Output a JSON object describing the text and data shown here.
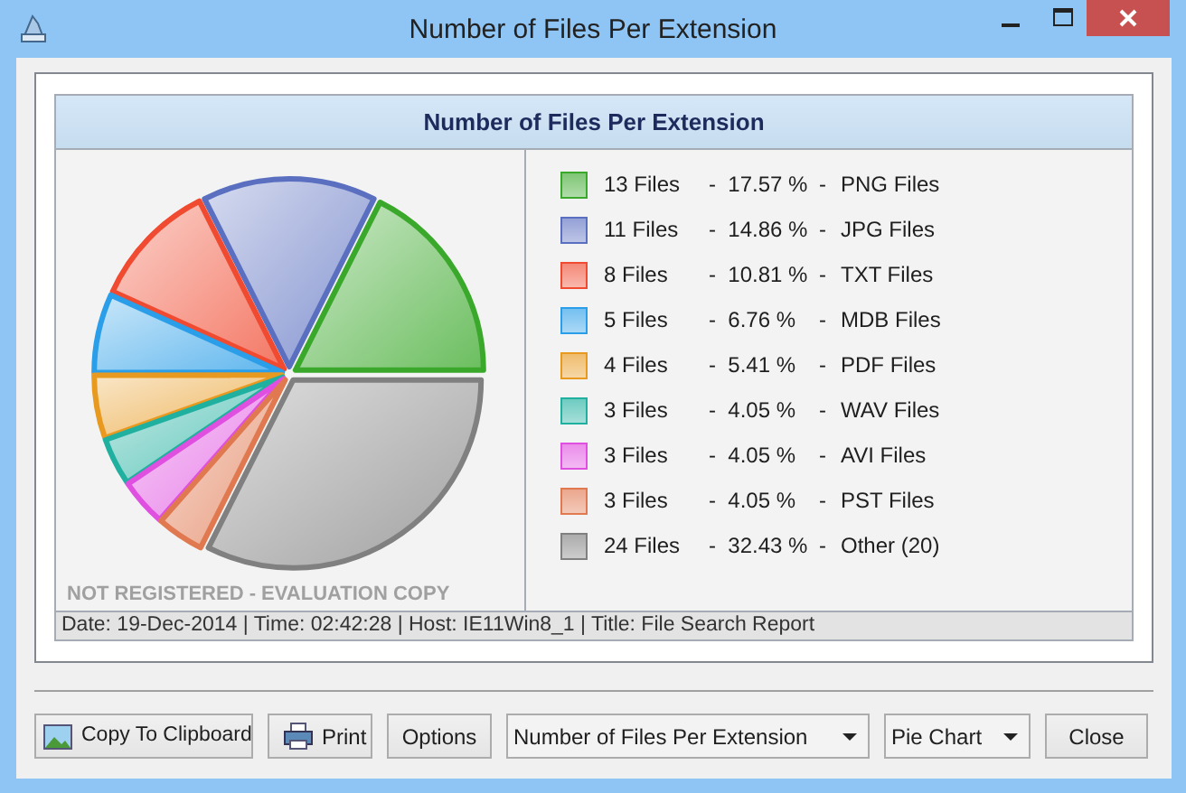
{
  "window": {
    "title": "Number of Files Per Extension"
  },
  "report": {
    "chart_data": {
      "type": "pie",
      "title": "Number of Files Per Extension",
      "categories": [
        "PNG Files",
        "JPG Files",
        "TXT Files",
        "MDB Files",
        "PDF Files",
        "WAV Files",
        "AVI Files",
        "PST Files",
        "Other (20)"
      ],
      "values": [
        17.57,
        14.86,
        10.81,
        6.76,
        5.41,
        4.05,
        4.05,
        4.05,
        32.43
      ]
    },
    "legend": [
      {
        "count": "13 Files",
        "percent": "-  17.57 %",
        "dash": "-",
        "color": "#3aa82a"
      },
      {
        "count": "11 Files",
        "percent": "-  14.86 %",
        "dash": "-",
        "color": "#5a6fc0"
      },
      {
        "count": "8 Files",
        "percent": "-  10.81 %",
        "dash": "-",
        "color": "#f04a30"
      },
      {
        "count": "5 Files",
        "percent": "-  6.76 %",
        "dash": "-",
        "color": "#2a9ee8"
      },
      {
        "count": "4 Files",
        "percent": "-  5.41 %",
        "dash": "-",
        "color": "#e89a20"
      },
      {
        "count": "3 Files",
        "percent": "-  4.05 %",
        "dash": "-",
        "color": "#20b0a0"
      },
      {
        "count": "3 Files",
        "percent": "-  4.05 %",
        "dash": "-",
        "color": "#e050e0"
      },
      {
        "count": "3 Files",
        "percent": "-  4.05 %",
        "dash": "-",
        "color": "#e07850"
      },
      {
        "count": "24 Files",
        "percent": "-  32.43 %",
        "dash": "-",
        "color": "#808080"
      }
    ],
    "watermark": "NOT REGISTERED - EVALUATION COPY",
    "footer": "Date: 19-Dec-2014 | Time: 02:42:28 | Host: IE11Win8_1 | Title: File Search Report"
  },
  "toolbar": {
    "copy_button": "Copy To Clipboard",
    "print_button": "Print",
    "options_button": "Options",
    "report_select": "Number of Files Per Extension",
    "chart_select": "Pie Chart",
    "close_button": "Close"
  }
}
